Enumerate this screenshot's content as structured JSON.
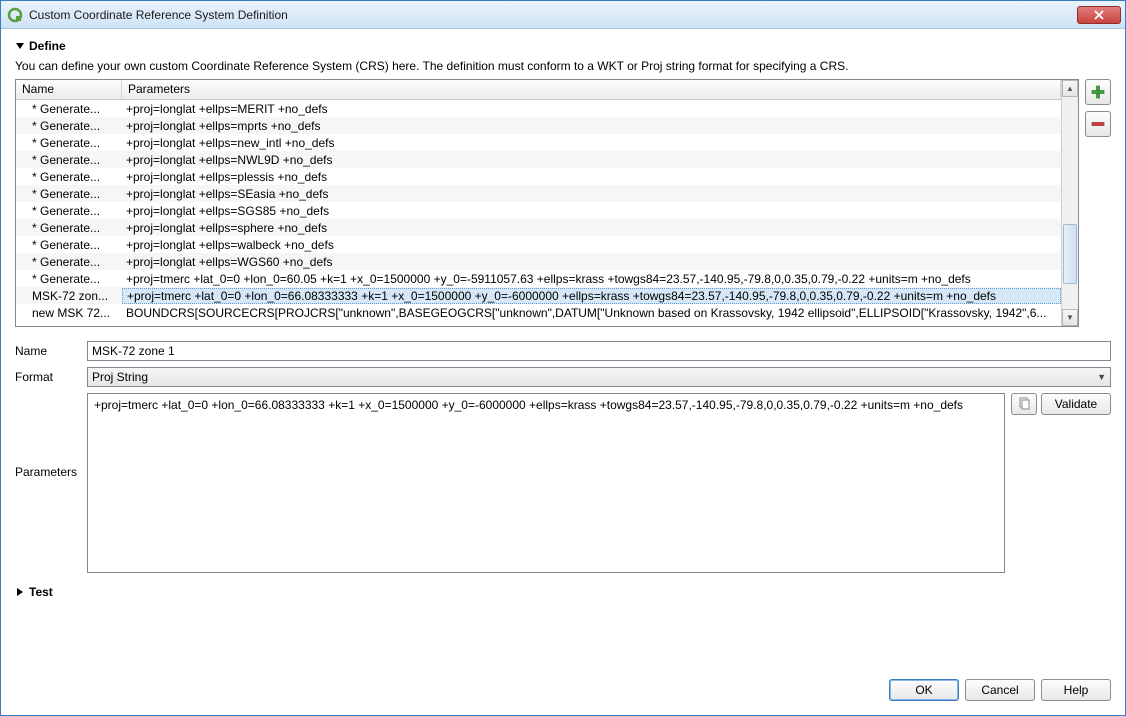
{
  "titlebar": {
    "title": "Custom Coordinate Reference System Definition"
  },
  "sections": {
    "define": "Define",
    "test": "Test"
  },
  "description": "You can define your own custom Coordinate Reference System (CRS) here. The definition must conform to a WKT or Proj string format for specifying a CRS.",
  "table": {
    "headers": {
      "name": "Name",
      "params": "Parameters"
    },
    "rows": [
      {
        "name": "* Generate...",
        "params": "+proj=longlat +ellps=MERIT +no_defs"
      },
      {
        "name": "* Generate...",
        "params": "+proj=longlat +ellps=mprts +no_defs"
      },
      {
        "name": "* Generate...",
        "params": "+proj=longlat +ellps=new_intl +no_defs"
      },
      {
        "name": "* Generate...",
        "params": "+proj=longlat +ellps=NWL9D +no_defs"
      },
      {
        "name": "* Generate...",
        "params": "+proj=longlat +ellps=plessis +no_defs"
      },
      {
        "name": "* Generate...",
        "params": "+proj=longlat +ellps=SEasia +no_defs"
      },
      {
        "name": "* Generate...",
        "params": "+proj=longlat +ellps=SGS85 +no_defs"
      },
      {
        "name": "* Generate...",
        "params": "+proj=longlat +ellps=sphere +no_defs"
      },
      {
        "name": "* Generate...",
        "params": "+proj=longlat +ellps=walbeck +no_defs"
      },
      {
        "name": "* Generate...",
        "params": "+proj=longlat +ellps=WGS60 +no_defs"
      },
      {
        "name": "* Generate...",
        "params": "+proj=tmerc +lat_0=0 +lon_0=60.05 +k=1 +x_0=1500000 +y_0=-5911057.63 +ellps=krass +towgs84=23.57,-140.95,-79.8,0,0.35,0.79,-0.22 +units=m +no_defs"
      },
      {
        "name": "MSK-72 zon...",
        "params": "+proj=tmerc +lat_0=0 +lon_0=66.08333333 +k=1 +x_0=1500000 +y_0=-6000000 +ellps=krass +towgs84=23.57,-140.95,-79.8,0,0.35,0.79,-0.22 +units=m +no_defs",
        "selected": true
      },
      {
        "name": "new MSK 72...",
        "params": "BOUNDCRS[SOURCECRS[PROJCRS[\"unknown\",BASEGEOGCRS[\"unknown\",DATUM[\"Unknown based on Krassovsky, 1942 ellipsoid\",ELLIPSOID[\"Krassovsky, 1942\",6..."
      }
    ],
    "selected_index": 11
  },
  "form": {
    "name_label": "Name",
    "name_value": "MSK-72 zone 1",
    "format_label": "Format",
    "format_value": "Proj String",
    "parameters_label": "Parameters",
    "parameters_value": "+proj=tmerc +lat_0=0 +lon_0=66.08333333 +k=1 +x_0=1500000 +y_0=-6000000 +ellps=krass +towgs84=23.57,-140.95,-79.8,0,0.35,0.79,-0.22 +units=m +no_defs",
    "validate_label": "Validate"
  },
  "buttons": {
    "ok": "OK",
    "cancel": "Cancel",
    "help": "Help"
  },
  "icons": {
    "add": "plus-icon",
    "remove": "minus-icon",
    "copy": "copy-icon",
    "close": "close-icon"
  }
}
